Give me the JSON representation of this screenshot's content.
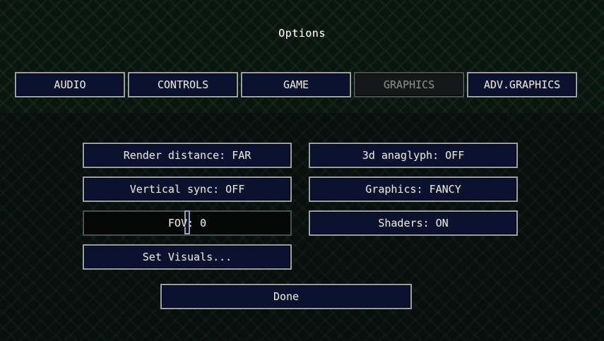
{
  "title": "Options",
  "tabs": [
    {
      "label": "AUDIO",
      "active": false
    },
    {
      "label": "CONTROLS",
      "active": false
    },
    {
      "label": "GAME",
      "active": false
    },
    {
      "label": "GRAPHICS",
      "active": true
    },
    {
      "label": "ADV.GRAPHICS",
      "active": false
    }
  ],
  "settings": {
    "render_distance": "Render distance: FAR",
    "anaglyph": "3d anaglyph: OFF",
    "vsync": "Vertical sync: OFF",
    "graphics": "Graphics: FANCY",
    "fov": {
      "label": "FOV: 0",
      "value": 0
    },
    "shaders": "Shaders: ON",
    "set_visuals": "Set Visuals..."
  },
  "done_label": "Done",
  "colors": {
    "button_fill": "#0b1230",
    "button_border": "#9aa0aa",
    "active_tab_fill": "#141818"
  }
}
